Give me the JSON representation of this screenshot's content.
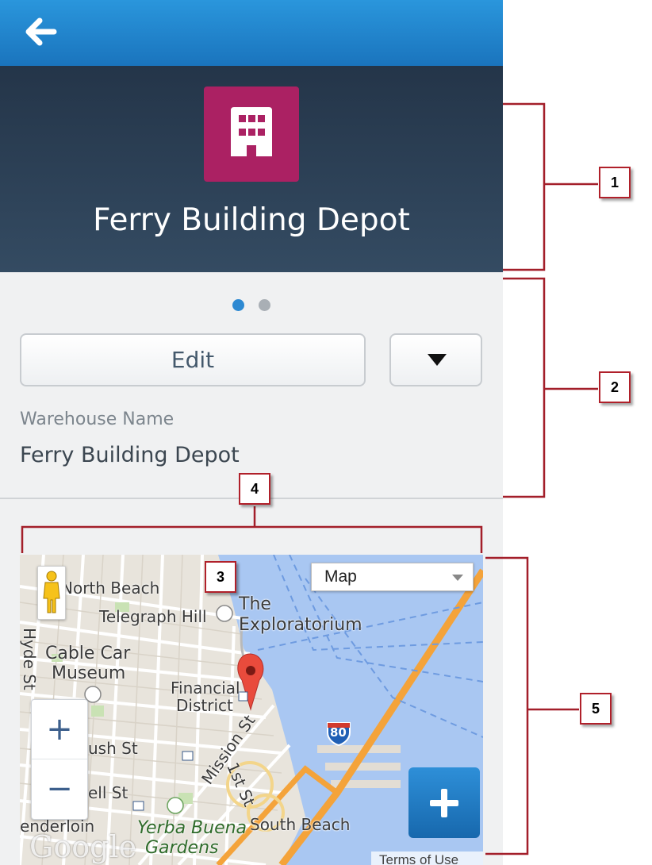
{
  "header": {
    "back_icon": "arrow-left-icon",
    "title": "Ferry Building Depot",
    "record_icon": "building-icon",
    "record_icon_color": "#ab2163"
  },
  "pager": {
    "page_count": 2,
    "active_page": 1
  },
  "actions": {
    "edit_label": "Edit",
    "more_icon": "triangle-down-icon"
  },
  "detail": {
    "field_label": "Warehouse Name",
    "field_value": "Ferry Building Depot"
  },
  "map": {
    "type_select": "Map",
    "labels": {
      "north_beach": "North Beach",
      "telegraph_hill": "Telegraph Hill",
      "the": "The",
      "exploratorium": "Exploratorium",
      "cable_car": "Cable Car",
      "museum": "Museum",
      "financial": "Financial",
      "district": "District",
      "hyde_st": "Hyde St",
      "mission_st": "Mission St",
      "first_st": "1st St",
      "bush_st": "ush St",
      "bell_st": "ell St",
      "tenderloin": "enderloin",
      "yerba_buena": "Yerba Buena",
      "gardens": "Gardens",
      "south_beach": "South Beach",
      "highway": "80"
    },
    "zoom_in": "+",
    "zoom_out": "−",
    "google": "Google",
    "terms": "Terms of Use"
  },
  "callouts": [
    "1",
    "2",
    "3",
    "4",
    "5"
  ],
  "colors": {
    "accent": "#2a96dc",
    "hero": "#2b3e53",
    "callout_border": "#b0202a",
    "highway": "#f4a33a",
    "water": "#a9c7f2"
  }
}
